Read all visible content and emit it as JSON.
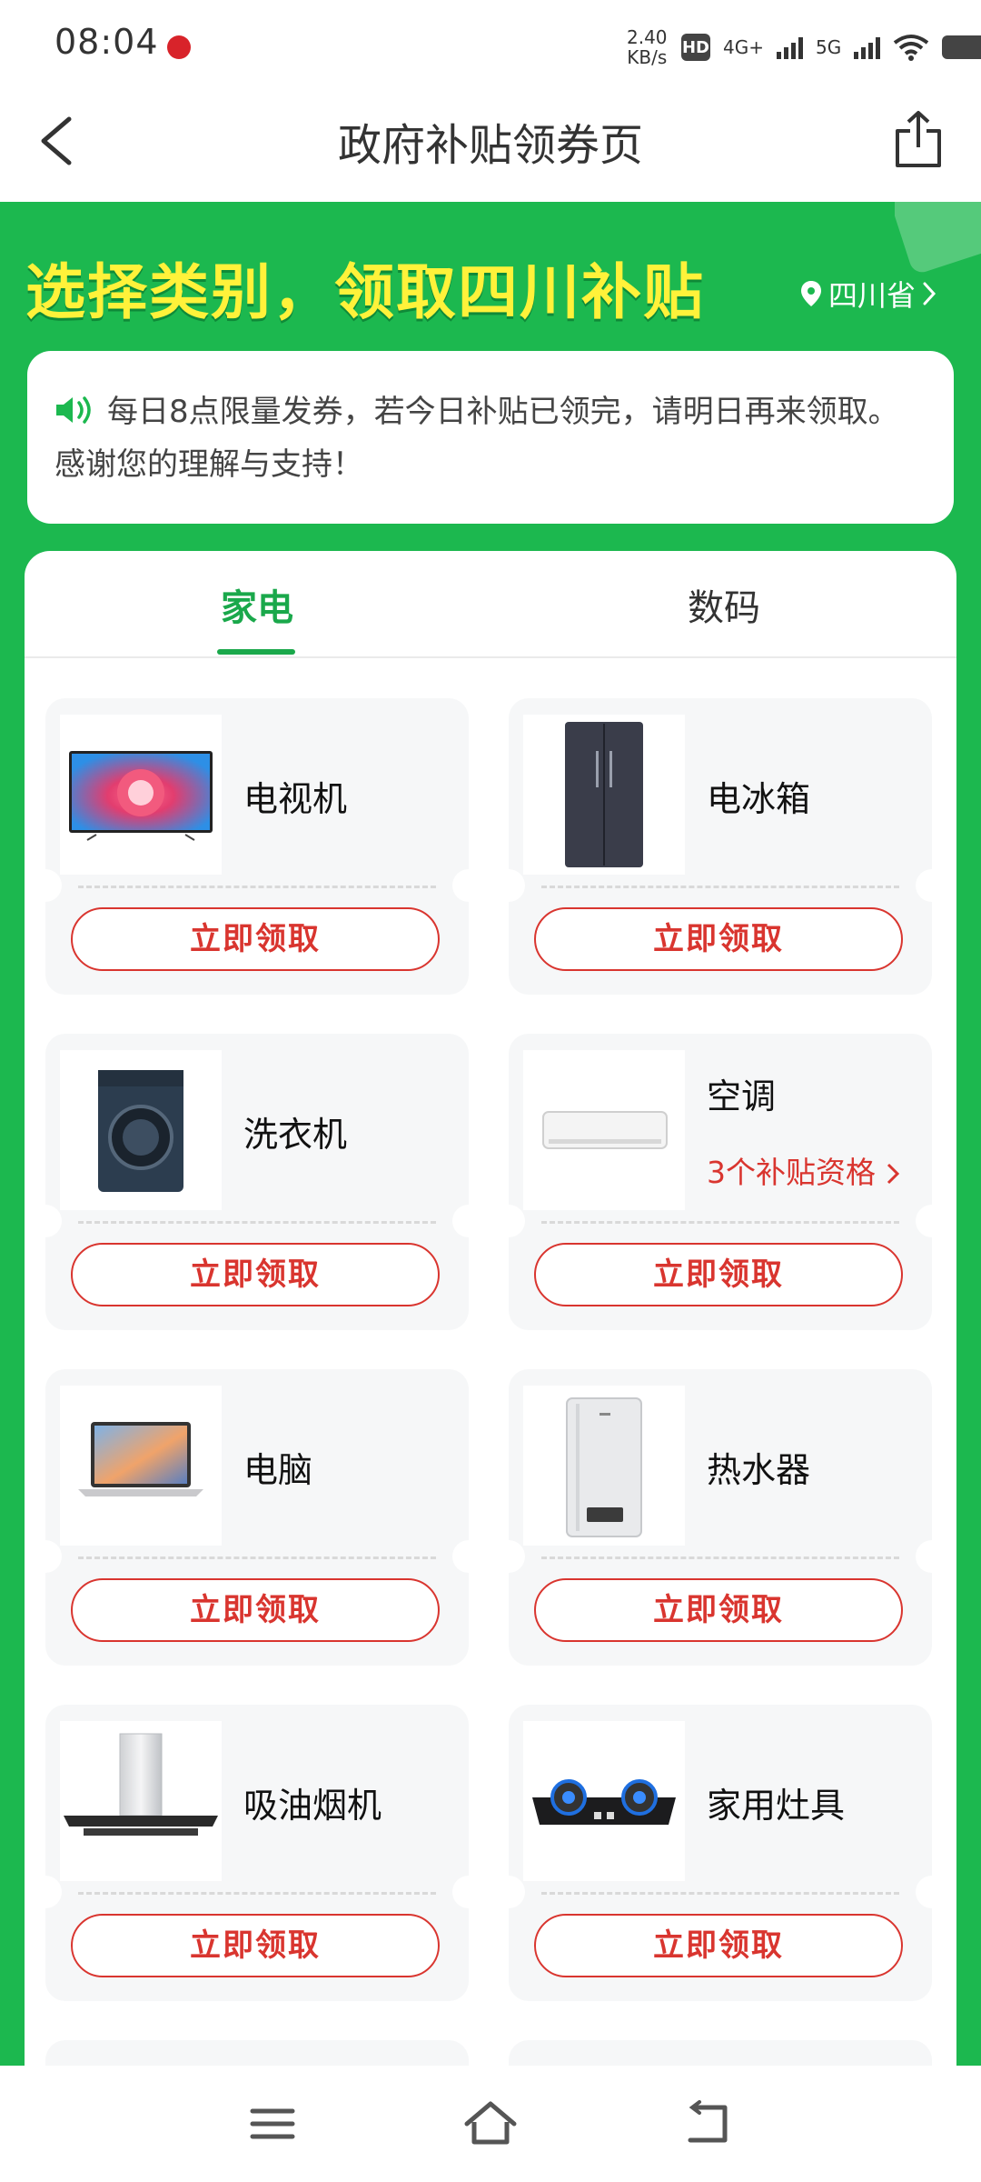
{
  "status_bar": {
    "time": "08:04",
    "net_speed": "2.40",
    "net_unit": "KB/s",
    "hd": "HD",
    "sim1": "4G+",
    "sim2": "5G"
  },
  "header": {
    "title": "政府补贴领券页"
  },
  "banner": {
    "headline": "选择类别，领取四川补贴",
    "location": "四川省"
  },
  "notice": {
    "text": "每日8点限量发券，若今日补贴已领完，请明日再来领取。感谢您的理解与支持！"
  },
  "tabs": [
    {
      "label": "家电",
      "active": true
    },
    {
      "label": "数码",
      "active": false
    }
  ],
  "products": [
    {
      "name": "电视机",
      "button": "立即领取"
    },
    {
      "name": "电冰箱",
      "button": "立即领取"
    },
    {
      "name": "洗衣机",
      "button": "立即领取"
    },
    {
      "name": "空调",
      "button": "立即领取",
      "quota": "3个补贴资格"
    },
    {
      "name": "电脑",
      "button": "立即领取"
    },
    {
      "name": "热水器",
      "button": "立即领取"
    },
    {
      "name": "吸油烟机",
      "button": "立即领取"
    },
    {
      "name": "家用灶具",
      "button": "立即领取"
    }
  ],
  "colors": {
    "brand_green": "#1cb84f",
    "headline_yellow": "#fff23a",
    "action_red": "#d9352f"
  }
}
